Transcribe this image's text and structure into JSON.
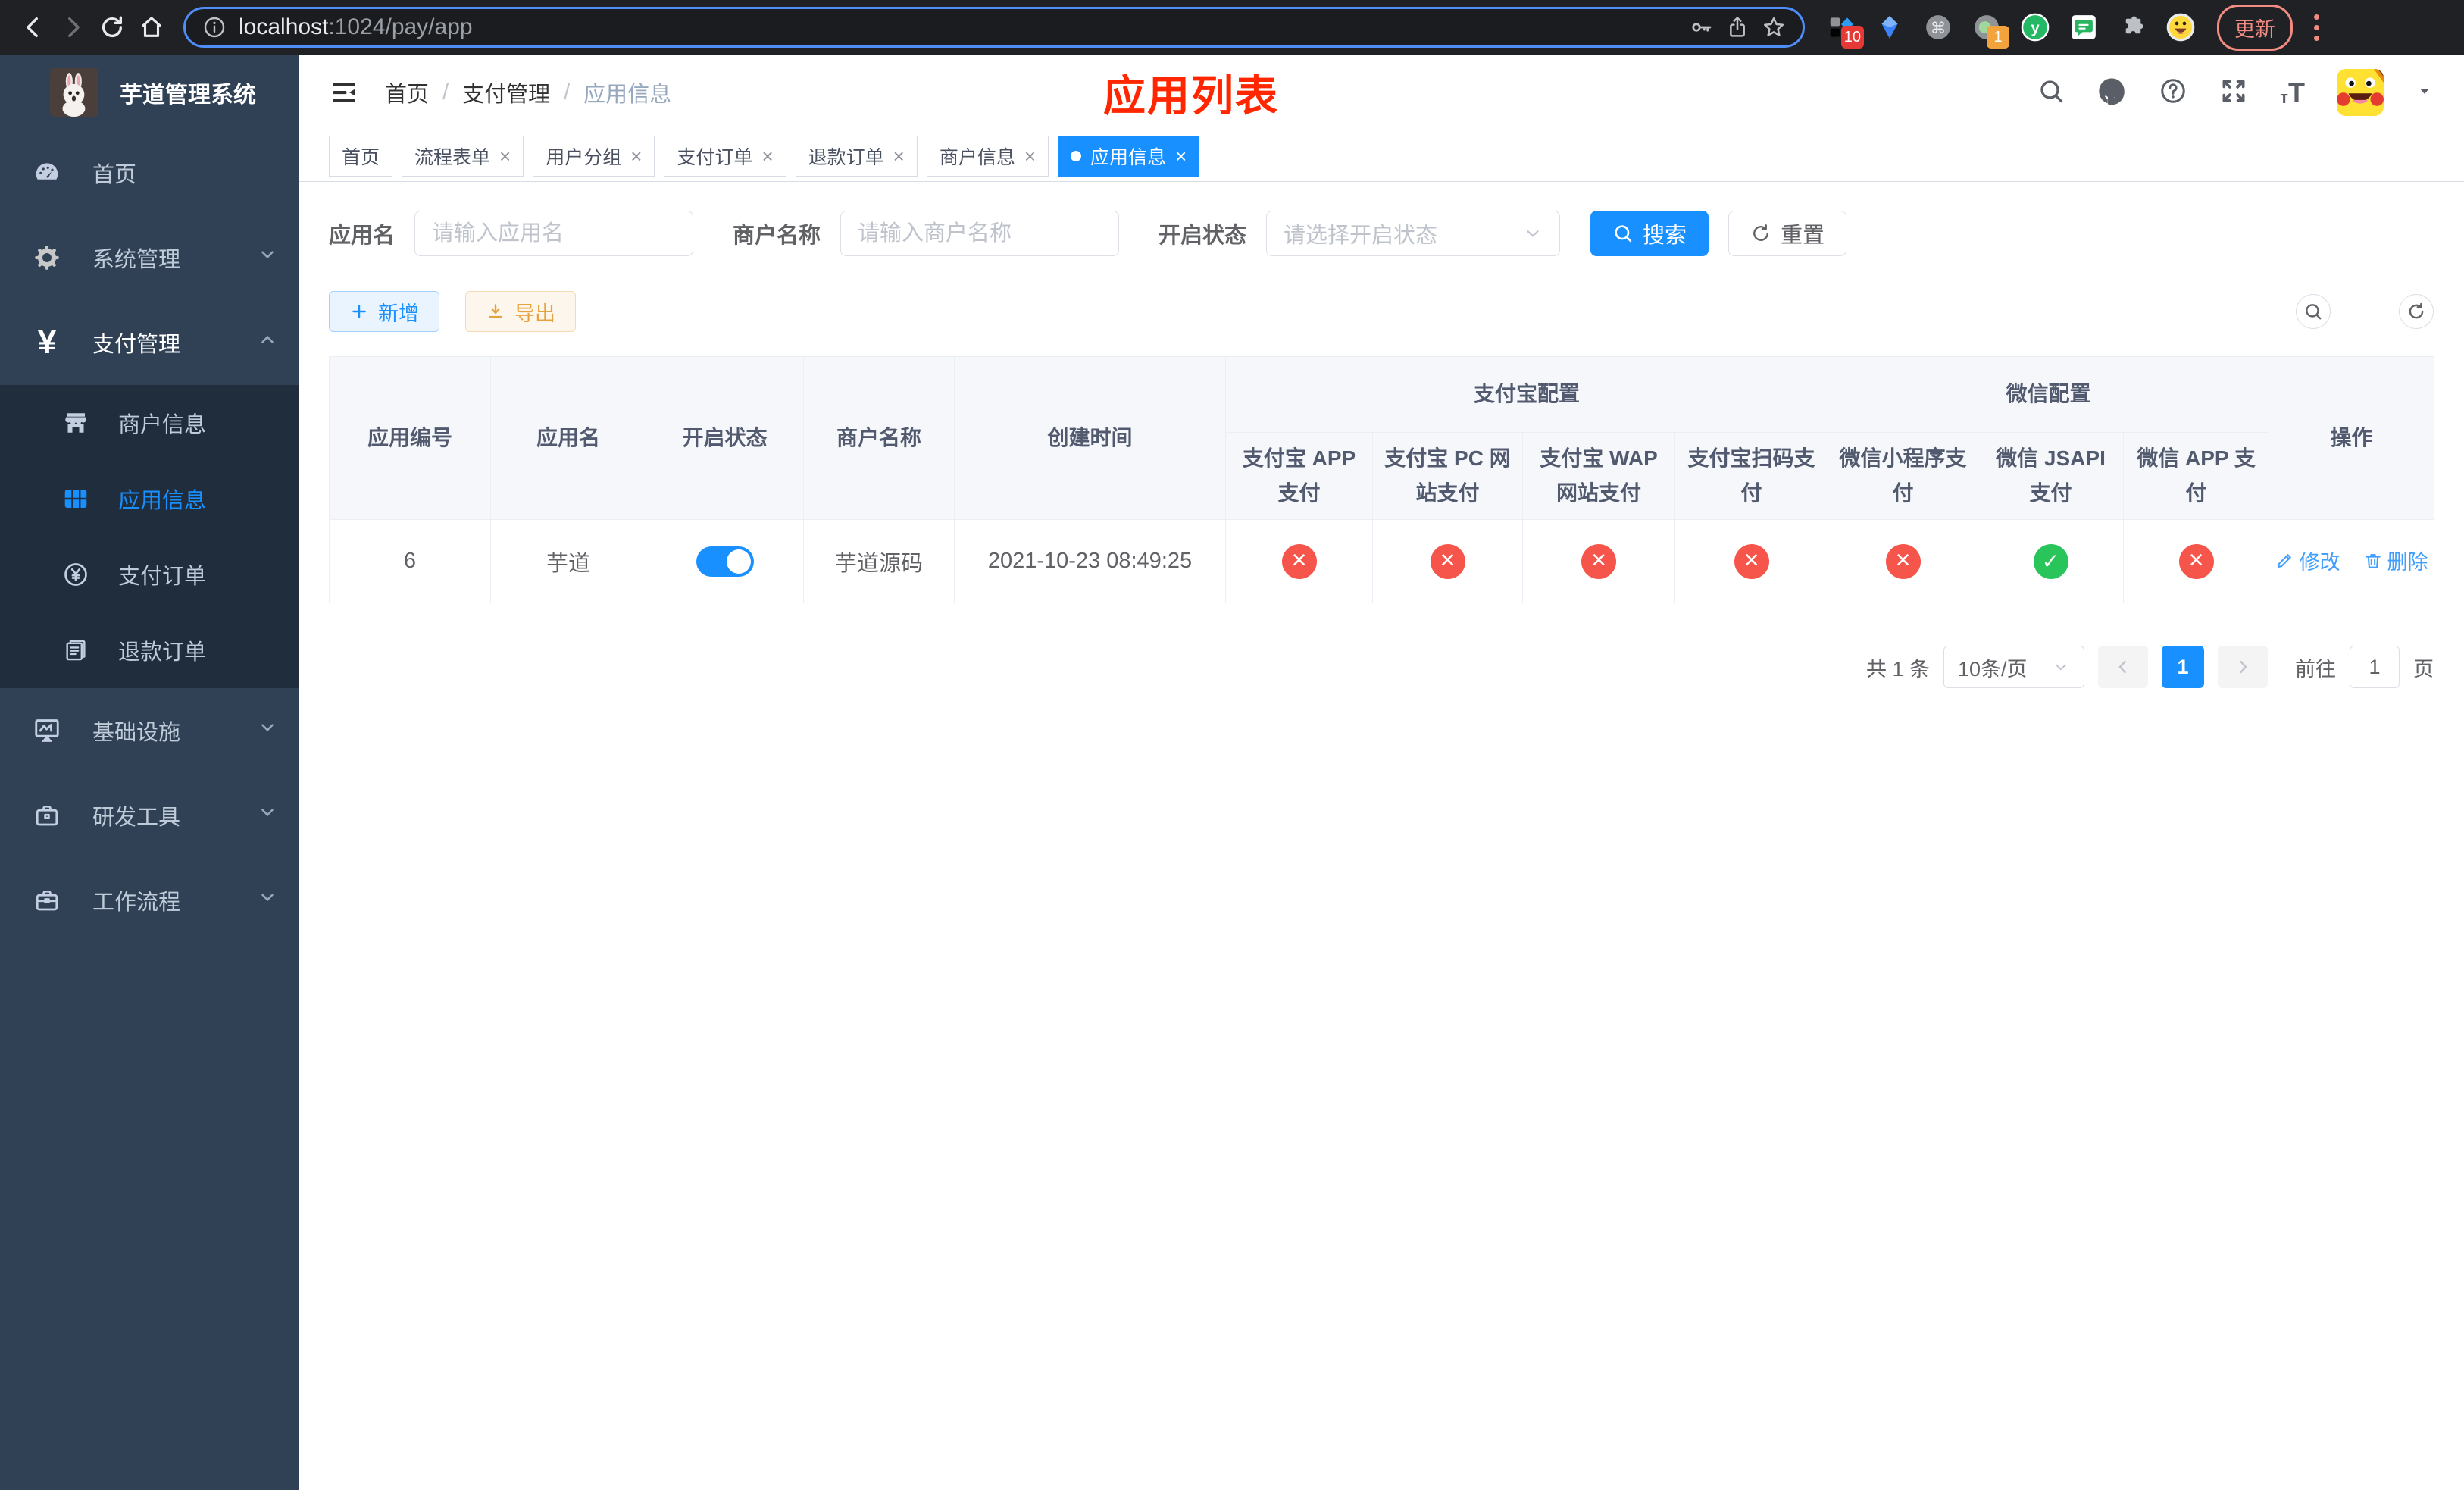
{
  "colors": {
    "accent": "#1890ff",
    "link": "#409eff",
    "danger": "#f5554a",
    "success": "#29c45a",
    "annotation": "#ff2600",
    "sidebar_bg": "#304156",
    "submenu_bg": "#1f2d3d"
  },
  "browser": {
    "url_host": "localhost",
    "url_path": ":1024/pay/app",
    "update_label": "更新",
    "badges": {
      "ext10": "10",
      "ext1": "1"
    }
  },
  "sidebar": {
    "title": "芋道管理系统",
    "items": [
      {
        "label": "首页"
      },
      {
        "label": "系统管理"
      },
      {
        "label": "支付管理"
      },
      {
        "label": "商户信息"
      },
      {
        "label": "应用信息"
      },
      {
        "label": "支付订单"
      },
      {
        "label": "退款订单"
      },
      {
        "label": "基础设施"
      },
      {
        "label": "研发工具"
      },
      {
        "label": "工作流程"
      }
    ]
  },
  "header": {
    "breadcrumb": [
      "首页",
      "支付管理",
      "应用信息"
    ],
    "separator": "/",
    "annotation": "应用列表"
  },
  "tabs": [
    {
      "label": "首页"
    },
    {
      "label": "流程表单"
    },
    {
      "label": "用户分组"
    },
    {
      "label": "支付订单"
    },
    {
      "label": "退款订单"
    },
    {
      "label": "商户信息"
    },
    {
      "label": "应用信息"
    }
  ],
  "filters": {
    "app_name_label": "应用名",
    "app_name_placeholder": "请输入应用名",
    "merchant_label": "商户名称",
    "merchant_placeholder": "请输入商户名称",
    "status_label": "开启状态",
    "status_placeholder": "请选择开启状态",
    "search_label": "搜索",
    "reset_label": "重置"
  },
  "toolbar": {
    "add_label": "新增",
    "export_label": "导出"
  },
  "table": {
    "columns": [
      "应用编号",
      "应用名",
      "开启状态",
      "商户名称",
      "创建时间"
    ],
    "group_alipay": "支付宝配置",
    "alipay_cols": [
      "支付宝 APP 支付",
      "支付宝 PC 网站支付",
      "支付宝 WAP 网站支付",
      "支付宝扫码支付"
    ],
    "group_wechat": "微信配置",
    "wechat_cols": [
      "微信小程序支付",
      "微信 JSAPI 支付",
      "微信 APP 支付"
    ],
    "actions_col": "操作",
    "rows": [
      {
        "id": "6",
        "name": "芋道",
        "enabled": true,
        "merchant": "芋道源码",
        "created": "2021-10-23 08:49:25",
        "alipay": [
          false,
          false,
          false,
          false
        ],
        "wechat": [
          false,
          true,
          false
        ],
        "edit_label": "修改",
        "delete_label": "删除"
      }
    ]
  },
  "pagination": {
    "total": "共 1 条",
    "page_size": "10条/页",
    "current": "1",
    "goto_label": "前往",
    "goto_value": "1",
    "page_label": "页"
  }
}
